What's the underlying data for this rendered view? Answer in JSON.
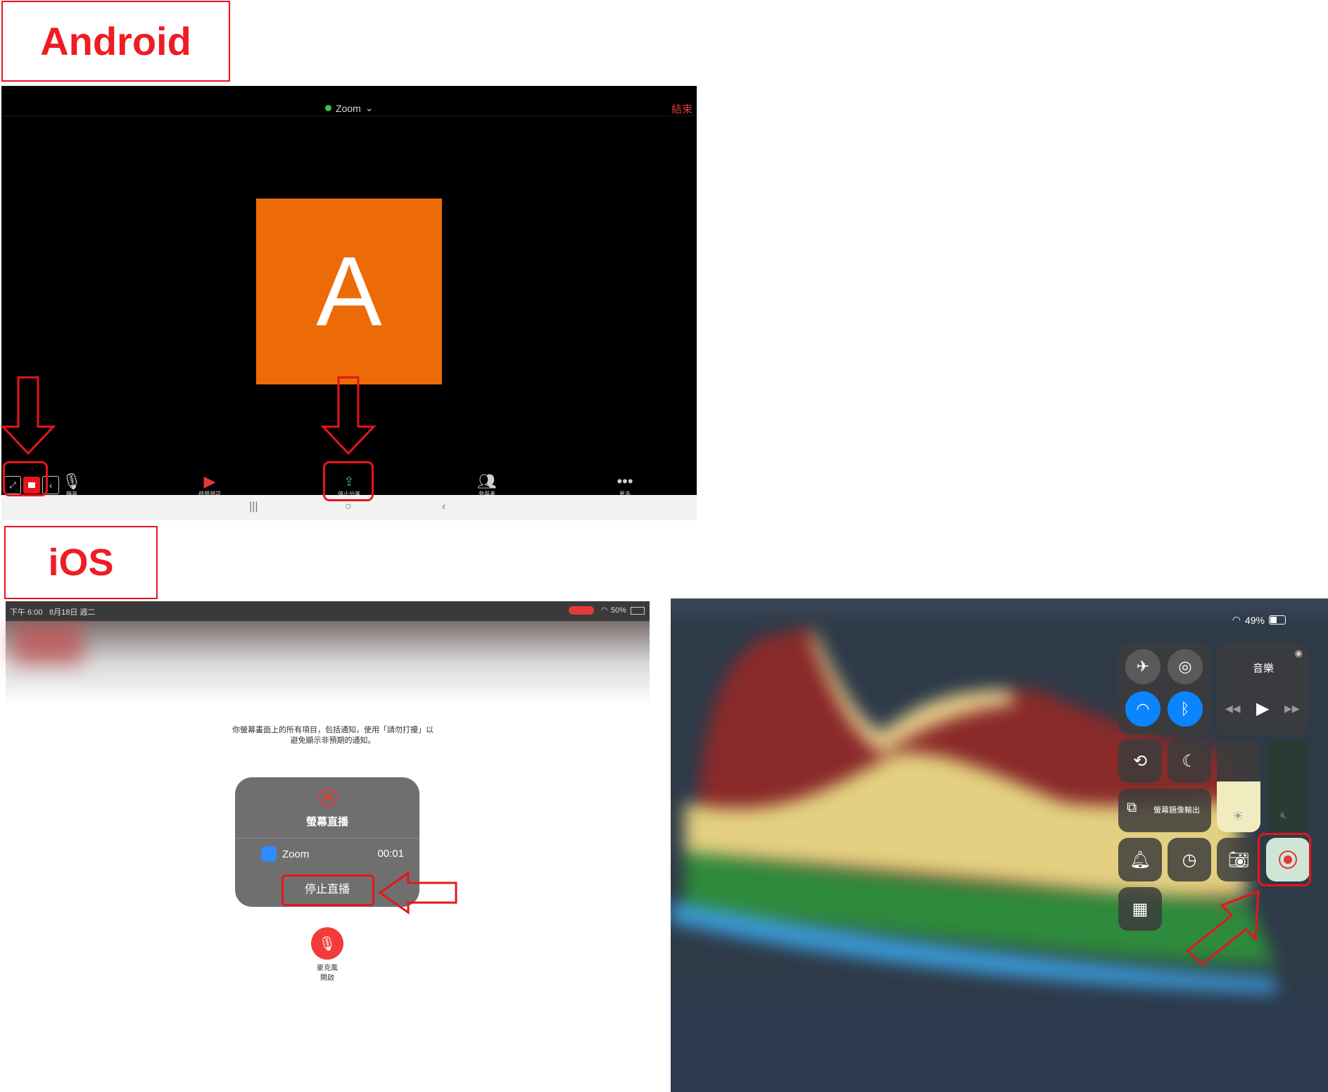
{
  "labels": {
    "android": "Android",
    "ios": "iOS"
  },
  "android": {
    "top_bar": {
      "app_title": "Zoom",
      "end_label": "結束"
    },
    "avatar_letter": "A",
    "toolbar": [
      {
        "name": "mute-button",
        "label": "靜音",
        "icon": "microphone-icon"
      },
      {
        "name": "video-button",
        "label": "啟用視訊",
        "icon": "camera-off-icon"
      },
      {
        "name": "stop-share-button",
        "label": "停止分享",
        "icon": "stop-share-icon"
      },
      {
        "name": "participants-button",
        "label": "參與者",
        "icon": "participants-icon"
      },
      {
        "name": "more-button",
        "label": "更多",
        "icon": "more-icon"
      }
    ],
    "floating_share_control": {
      "label": "停止分享"
    },
    "nav_bar": {
      "recents": "|||",
      "home": "○",
      "back": "‹"
    },
    "highlight_color": "#e8141c"
  },
  "ios_broadcast": {
    "status_bar": {
      "time": "下午 6:00",
      "date": "8月18日 週二",
      "battery": "50%"
    },
    "description": "你螢幕畫面上的所有項目，包括通知，使用「請勿打擾」以避免顯示非預期的通知。",
    "panel": {
      "title": "螢幕直播",
      "app_name": "Zoom",
      "elapsed": "00:01",
      "stop_button": "停止直播"
    },
    "microphone": {
      "label_line1": "麥克風",
      "label_line2": "開啟"
    }
  },
  "ios_control_center": {
    "status": {
      "battery": "49%"
    },
    "music": {
      "title": "音樂"
    },
    "screen_mirroring": "螢幕鏡像輸出",
    "colors": {
      "accent_blue": "#0a84ff",
      "record_red": "#e23a3a"
    }
  }
}
